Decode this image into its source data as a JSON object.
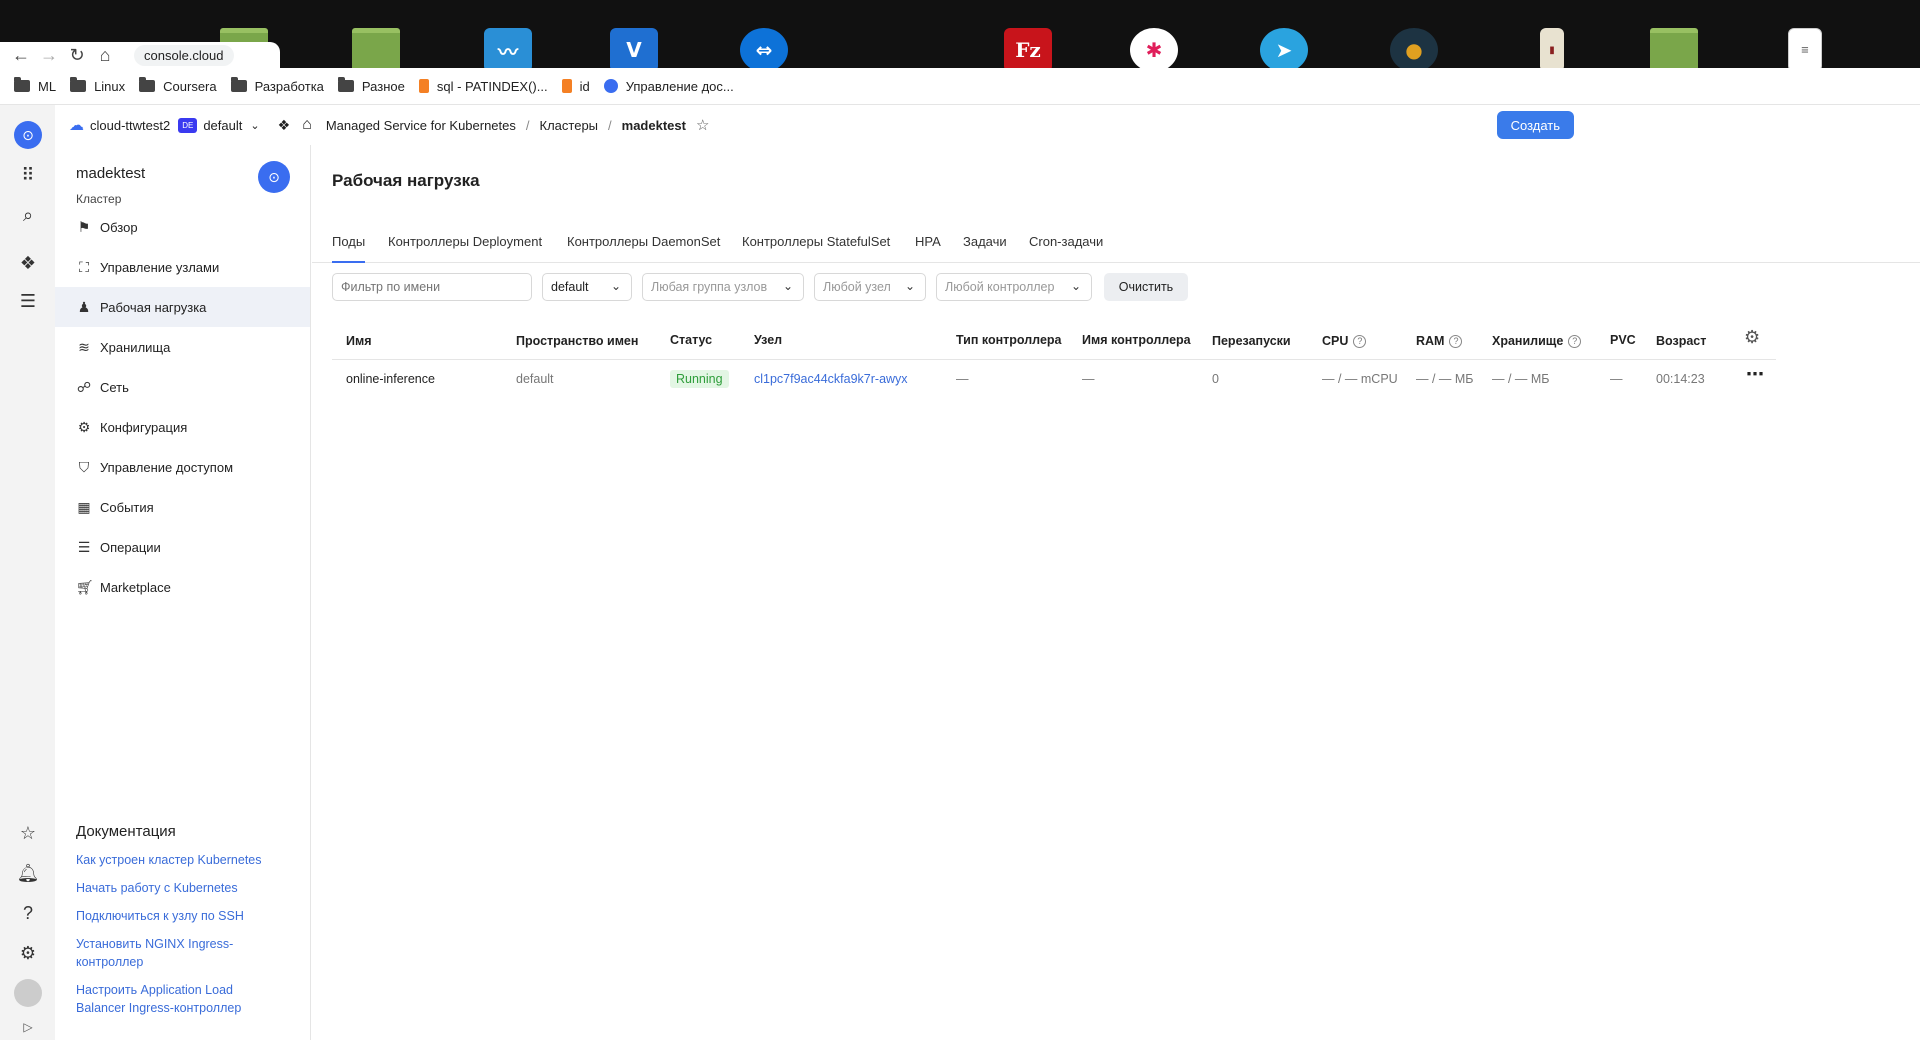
{
  "browser": {
    "url": "console.cloud",
    "bookmarks": [
      {
        "label": "ML",
        "icon": "folder-icon"
      },
      {
        "label": "Linux",
        "icon": "folder-icon"
      },
      {
        "label": "Coursera",
        "icon": "folder-icon"
      },
      {
        "label": "Разработка",
        "icon": "folder-icon"
      },
      {
        "label": "Разное",
        "icon": "folder-icon"
      },
      {
        "label": "sql - PATINDEX()...",
        "icon": "stackoverflow-icon"
      },
      {
        "label": "id",
        "icon": "stackoverflow-icon"
      },
      {
        "label": "Управление дос...",
        "icon": "globe-icon"
      }
    ]
  },
  "topbar": {
    "cloud": "cloud-ttwtest2",
    "folder_badge": "DE",
    "folder": "default",
    "crumbs": [
      "Managed Service for Kubernetes",
      "Кластеры",
      "madektest"
    ],
    "create_label": "Создать"
  },
  "sidebar": {
    "cluster_name": "madektest",
    "cluster_type": "Кластер",
    "items": [
      {
        "label": "Обзор",
        "icon": "flag-icon"
      },
      {
        "label": "Управление узлами",
        "icon": "nodes-icon"
      },
      {
        "label": "Рабочая нагрузка",
        "icon": "workload-icon"
      },
      {
        "label": "Хранилища",
        "icon": "database-icon"
      },
      {
        "label": "Сеть",
        "icon": "network-icon"
      },
      {
        "label": "Конфигурация",
        "icon": "gears-icon"
      },
      {
        "label": "Управление доступом",
        "icon": "shield-icon"
      },
      {
        "label": "События",
        "icon": "calendar-icon"
      },
      {
        "label": "Операции",
        "icon": "list-icon"
      },
      {
        "label": "Marketplace",
        "icon": "cart-icon"
      }
    ],
    "docs_title": "Документация",
    "docs": [
      "Как устроен кластер Kubernetes",
      "Начать работу с Kubernetes",
      "Подключиться к узлу по SSH",
      "Установить NGINX Ingress-контроллер",
      "Настроить Application Load Balancer Ingress-контроллер"
    ]
  },
  "main": {
    "title": "Рабочая нагрузка",
    "tabs": [
      "Поды",
      "Контроллеры Deployment",
      "Контроллеры DaemonSet",
      "Контроллеры StatefulSet",
      "HPA",
      "Задачи",
      "Cron-задачи"
    ],
    "filters": {
      "name_placeholder": "Фильтр по имени",
      "namespace": "default",
      "node_group": "Любая группа узлов",
      "node": "Любой узел",
      "controller": "Любой контроллер",
      "clear": "Очистить"
    },
    "table": {
      "headers": [
        "Имя",
        "Пространство имен",
        "Статус",
        "Узел",
        "Тип контроллера",
        "Имя контроллера",
        "Перезапуски",
        "CPU",
        "RAM",
        "Хранилище",
        "PVC",
        "Возраст"
      ],
      "rows": [
        {
          "name": "online-inference",
          "namespace": "default",
          "status": "Running",
          "node": "cl1pc7f9ac44ckfa9k7r-awyx",
          "controller_type": "—",
          "controller_name": "—",
          "restarts": "0",
          "cpu": "— / — mCPU",
          "ram": "— / — МБ",
          "storage": "— / — МБ",
          "pvc": "—",
          "age": "00:14:23"
        }
      ]
    }
  }
}
